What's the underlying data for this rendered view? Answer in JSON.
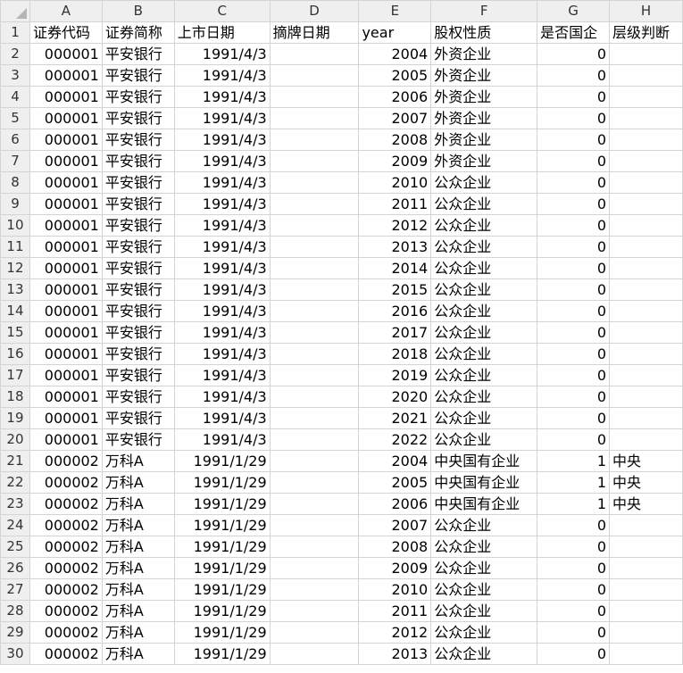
{
  "columns": [
    "A",
    "B",
    "C",
    "D",
    "E",
    "F",
    "G",
    "H"
  ],
  "headers": [
    "证券代码",
    "证券简称",
    "上市日期",
    "摘牌日期",
    "year",
    "股权性质",
    "是否国企",
    "层级判断"
  ],
  "rows": [
    [
      "000001",
      "平安银行",
      "1991/4/3",
      "",
      "2004",
      "外资企业",
      "0",
      ""
    ],
    [
      "000001",
      "平安银行",
      "1991/4/3",
      "",
      "2005",
      "外资企业",
      "0",
      ""
    ],
    [
      "000001",
      "平安银行",
      "1991/4/3",
      "",
      "2006",
      "外资企业",
      "0",
      ""
    ],
    [
      "000001",
      "平安银行",
      "1991/4/3",
      "",
      "2007",
      "外资企业",
      "0",
      ""
    ],
    [
      "000001",
      "平安银行",
      "1991/4/3",
      "",
      "2008",
      "外资企业",
      "0",
      ""
    ],
    [
      "000001",
      "平安银行",
      "1991/4/3",
      "",
      "2009",
      "外资企业",
      "0",
      ""
    ],
    [
      "000001",
      "平安银行",
      "1991/4/3",
      "",
      "2010",
      "公众企业",
      "0",
      ""
    ],
    [
      "000001",
      "平安银行",
      "1991/4/3",
      "",
      "2011",
      "公众企业",
      "0",
      ""
    ],
    [
      "000001",
      "平安银行",
      "1991/4/3",
      "",
      "2012",
      "公众企业",
      "0",
      ""
    ],
    [
      "000001",
      "平安银行",
      "1991/4/3",
      "",
      "2013",
      "公众企业",
      "0",
      ""
    ],
    [
      "000001",
      "平安银行",
      "1991/4/3",
      "",
      "2014",
      "公众企业",
      "0",
      ""
    ],
    [
      "000001",
      "平安银行",
      "1991/4/3",
      "",
      "2015",
      "公众企业",
      "0",
      ""
    ],
    [
      "000001",
      "平安银行",
      "1991/4/3",
      "",
      "2016",
      "公众企业",
      "0",
      ""
    ],
    [
      "000001",
      "平安银行",
      "1991/4/3",
      "",
      "2017",
      "公众企业",
      "0",
      ""
    ],
    [
      "000001",
      "平安银行",
      "1991/4/3",
      "",
      "2018",
      "公众企业",
      "0",
      ""
    ],
    [
      "000001",
      "平安银行",
      "1991/4/3",
      "",
      "2019",
      "公众企业",
      "0",
      ""
    ],
    [
      "000001",
      "平安银行",
      "1991/4/3",
      "",
      "2020",
      "公众企业",
      "0",
      ""
    ],
    [
      "000001",
      "平安银行",
      "1991/4/3",
      "",
      "2021",
      "公众企业",
      "0",
      ""
    ],
    [
      "000001",
      "平安银行",
      "1991/4/3",
      "",
      "2022",
      "公众企业",
      "0",
      ""
    ],
    [
      "000002",
      "万科A",
      "1991/1/29",
      "",
      "2004",
      "中央国有企业",
      "1",
      "中央"
    ],
    [
      "000002",
      "万科A",
      "1991/1/29",
      "",
      "2005",
      "中央国有企业",
      "1",
      "中央"
    ],
    [
      "000002",
      "万科A",
      "1991/1/29",
      "",
      "2006",
      "中央国有企业",
      "1",
      "中央"
    ],
    [
      "000002",
      "万科A",
      "1991/1/29",
      "",
      "2007",
      "公众企业",
      "0",
      ""
    ],
    [
      "000002",
      "万科A",
      "1991/1/29",
      "",
      "2008",
      "公众企业",
      "0",
      ""
    ],
    [
      "000002",
      "万科A",
      "1991/1/29",
      "",
      "2009",
      "公众企业",
      "0",
      ""
    ],
    [
      "000002",
      "万科A",
      "1991/1/29",
      "",
      "2010",
      "公众企业",
      "0",
      ""
    ],
    [
      "000002",
      "万科A",
      "1991/1/29",
      "",
      "2011",
      "公众企业",
      "0",
      ""
    ],
    [
      "000002",
      "万科A",
      "1991/1/29",
      "",
      "2012",
      "公众企业",
      "0",
      ""
    ],
    [
      "000002",
      "万科A",
      "1991/1/29",
      "",
      "2013",
      "公众企业",
      "0",
      ""
    ]
  ]
}
